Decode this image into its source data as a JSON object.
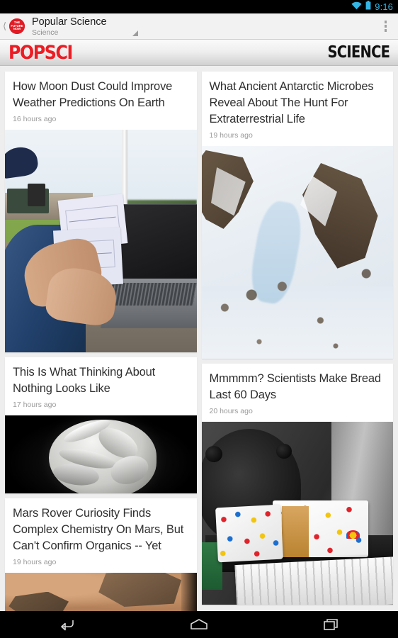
{
  "status_bar": {
    "time": "9:16",
    "wifi_icon": "wifi-icon",
    "battery_icon": "battery-icon",
    "accent_color": "#33b5e5"
  },
  "action_bar": {
    "up_icon": "back-chevron-icon",
    "app_logo_lines": [
      "THE",
      "FUTURE",
      "NOW"
    ],
    "logo_color": "#e01b24",
    "title": "Popular Science",
    "subtitle": "Science",
    "spinner_icon": "dropdown-triangle-icon",
    "overflow_icon": "overflow-menu-icon"
  },
  "banner": {
    "brand": "POPSCI",
    "section": "SCIENCE",
    "brand_color": "#ec1c24"
  },
  "feed": {
    "columns": [
      {
        "cards": [
          {
            "title": "How Moon Dust Could Improve Weather Predictions On Earth",
            "time": "16 hours ago",
            "image_name": "field-laptop-photo"
          },
          {
            "title": "This Is What Thinking About Nothing Looks Like",
            "time": "17 hours ago",
            "image_name": "brain-sculpture-photo"
          },
          {
            "title": "Mars Rover Curiosity Finds Complex Chemistry On Mars, But Can't Confirm Organics -- Yet",
            "time": "19 hours ago",
            "image_name": "mars-surface-photo"
          }
        ]
      },
      {
        "cards": [
          {
            "title": "What Ancient Antarctic Microbes Reveal About The Hunt For Extraterrestrial Life",
            "time": "19 hours ago",
            "image_name": "antarctic-aerial-photo"
          },
          {
            "title": "Mmmmm? Scientists Make Bread Last 60 Days",
            "time": "20 hours ago",
            "image_name": "bread-chamber-photo"
          }
        ]
      }
    ]
  },
  "nav_bar": {
    "back_icon": "back-icon",
    "home_icon": "home-icon",
    "recents_icon": "recents-icon"
  }
}
